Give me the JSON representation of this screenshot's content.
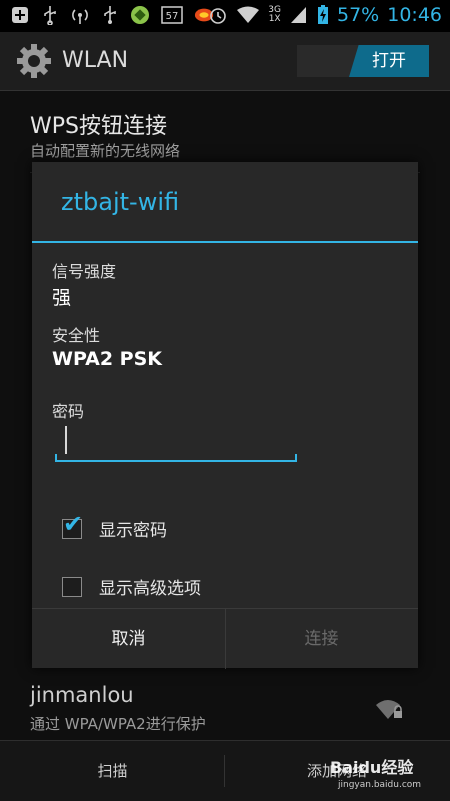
{
  "status_bar": {
    "icons_left": [
      "plus-icon",
      "usb-icon",
      "wifi-hotspot-icon",
      "usb-icon",
      "app-icon",
      "notification-57-icon",
      "app-icon-2"
    ],
    "notification_count": "57",
    "network_label_top": "3G",
    "network_label_bottom": "1X",
    "battery_percent": "57%",
    "time": "10:46"
  },
  "action_bar": {
    "title": "WLAN",
    "toggle_on_label": "打开"
  },
  "background_list": {
    "wps_title": "WPS按钮连接",
    "wps_subtitle": "自动配置新的无线网络",
    "network_name": "jinmanlou",
    "network_security": "通过 WPA/WPA2进行保护"
  },
  "dialog": {
    "title": "ztbajt-wifi",
    "signal_label": "信号强度",
    "signal_value": "强",
    "security_label": "安全性",
    "security_value": "WPA2 PSK",
    "password_label": "密码",
    "password_value": "",
    "show_password_label": "显示密码",
    "show_password_checked": true,
    "show_advanced_label": "显示高级选项",
    "show_advanced_checked": false,
    "cancel_label": "取消",
    "connect_label": "连接"
  },
  "bottom_bar": {
    "scan_label": "扫描",
    "add_label": "添加网络"
  },
  "watermark": {
    "text": "Baidu经验",
    "url": "jingyan.baidu.com"
  },
  "colors": {
    "accent": "#33b5e5",
    "toggle_on": "#0e6b8c",
    "dialog_bg": "#282828",
    "disabled_text": "#6a6a6a"
  }
}
